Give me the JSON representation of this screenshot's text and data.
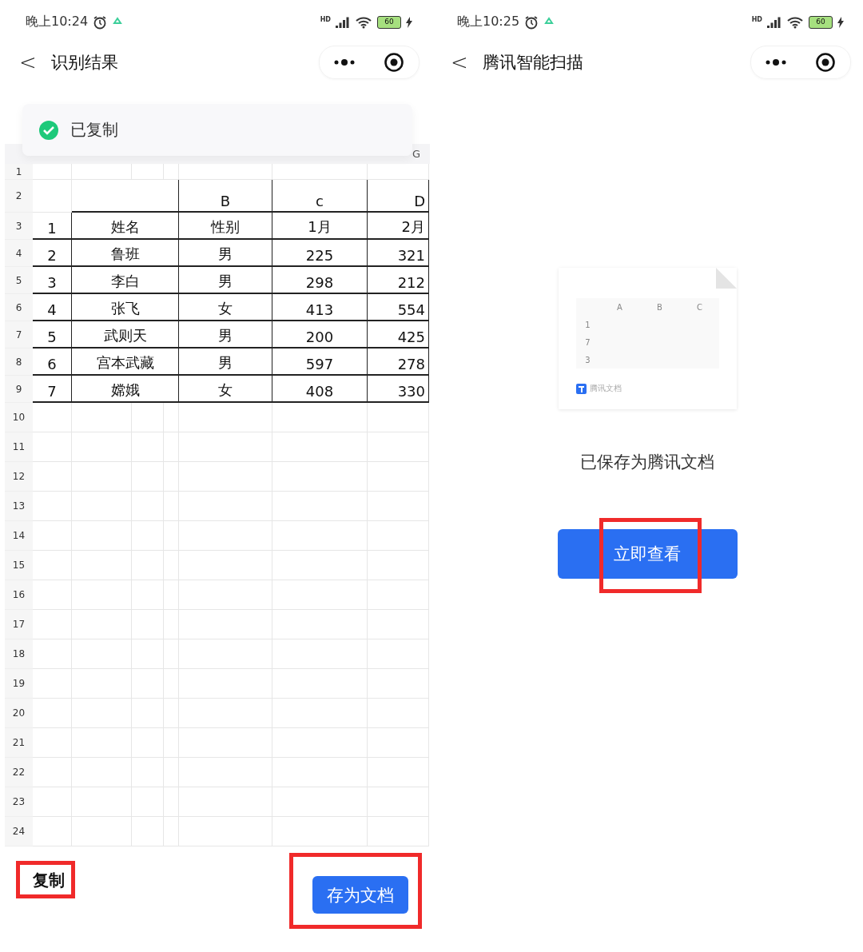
{
  "screens": [
    {
      "status_bar": {
        "time": "晚上10:24",
        "network": "HD",
        "battery": "60"
      },
      "nav": {
        "back": "<",
        "title": "识别结果"
      },
      "toast": {
        "text": "已复制"
      },
      "sheet": {
        "column_header": "G",
        "row_numbers": [
          "1",
          "2",
          "3",
          "4",
          "5",
          "6",
          "7",
          "8",
          "9",
          "10",
          "11",
          "12",
          "13",
          "14",
          "15",
          "16",
          "17",
          "18",
          "19",
          "20",
          "21",
          "22",
          "23",
          "24"
        ],
        "letter_row": [
          "B",
          "c",
          "D"
        ],
        "rows": [
          [
            "1",
            "姓名",
            "性别",
            "1月",
            "2月"
          ],
          [
            "2",
            "鲁班",
            "男",
            "225",
            "321"
          ],
          [
            "3",
            "李白",
            "男",
            "298",
            "212"
          ],
          [
            "4",
            "张飞",
            "女",
            "413",
            "554"
          ],
          [
            "5",
            "武则天",
            "男",
            "200",
            "425"
          ],
          [
            "6",
            "宫本武藏",
            "男",
            "597",
            "278"
          ],
          [
            "7",
            "嫦娥",
            "女",
            "408",
            "330"
          ]
        ]
      },
      "actions": [
        {
          "kind": "link",
          "label": "复制",
          "highlighted": true
        },
        {
          "kind": "primary",
          "label": "存为文档",
          "highlighted": true
        }
      ]
    },
    {
      "status_bar": {
        "time": "晚上10:25",
        "network": "HD",
        "battery": "60"
      },
      "nav": {
        "back": "<",
        "title": "腾讯智能扫描"
      },
      "preview": {
        "columns": [
          "A",
          "B",
          "C"
        ],
        "rows": [
          "1",
          "7",
          "3"
        ],
        "brand": "腾讯文档"
      },
      "message": "已保存为腾讯文档",
      "actions": [
        {
          "kind": "primary",
          "label": "立即查看",
          "highlighted": true
        }
      ]
    }
  ]
}
